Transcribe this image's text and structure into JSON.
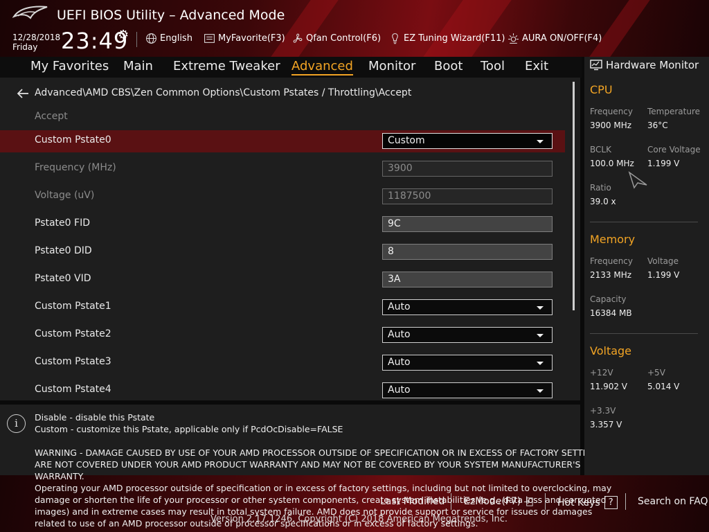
{
  "header": {
    "title": "UEFI BIOS Utility – Advanced Mode",
    "date": "12/28/2018",
    "day": "Friday",
    "time": "23:49",
    "buttons": [
      {
        "label": "English",
        "icon": "globe-icon"
      },
      {
        "label": "MyFavorite(F3)",
        "icon": "favorite-list-icon"
      },
      {
        "label": "Qfan Control(F6)",
        "icon": "fan-icon"
      },
      {
        "label": "EZ Tuning Wizard(F11)",
        "icon": "lightbulb-icon"
      },
      {
        "label": "AURA ON/OFF(F4)",
        "icon": "aura-light-icon"
      }
    ]
  },
  "menu": {
    "items": [
      "My Favorites",
      "Main",
      "Extreme Tweaker",
      "Advanced",
      "Monitor",
      "Boot",
      "Tool",
      "Exit"
    ],
    "active": "Advanced"
  },
  "main": {
    "breadcrumb": "Advanced\\AMD CBS\\Zen Common Options\\Custom Pstates / Throttling\\Accept",
    "subtitle": "Accept",
    "rows": [
      {
        "label": "Custom Pstate0",
        "value": "Custom",
        "type": "dropdown",
        "selected": true
      },
      {
        "label": "Frequency (MHz)",
        "value": "3900",
        "type": "field-disabled"
      },
      {
        "label": "Voltage (uV)",
        "value": "1187500",
        "type": "field-disabled"
      },
      {
        "label": "Pstate0 FID",
        "value": "9C",
        "type": "field"
      },
      {
        "label": "Pstate0 DID",
        "value": "8",
        "type": "field"
      },
      {
        "label": "Pstate0 VID",
        "value": "3A",
        "type": "field"
      },
      {
        "label": "Custom Pstate1",
        "value": "Auto",
        "type": "dropdown"
      },
      {
        "label": "Custom Pstate2",
        "value": "Auto",
        "type": "dropdown"
      },
      {
        "label": "Custom Pstate3",
        "value": "Auto",
        "type": "dropdown"
      },
      {
        "label": "Custom Pstate4",
        "value": "Auto",
        "type": "dropdown"
      }
    ]
  },
  "help": {
    "lines": [
      "Disable - disable this Pstate",
      "Custom - customize this Pstate, applicable only if PcdOcDisable=FALSE",
      "WARNING - DAMAGE CAUSED BY USE OF YOUR AMD PROCESSOR OUTSIDE OF SPECIFICATION OR IN EXCESS OF FACTORY SETTINGS",
      "ARE NOT COVERED UNDER YOUR AMD PRODUCT WARRANTY AND MAY NOT BE COVERED BY YOUR SYSTEM MANUFACTURER'S",
      "WARRANTY.",
      "Operating your AMD processor outside of specification or in excess of factory settings, including but not limited to overclocking, may",
      "damage or shorten the life of your processor or other system components, create system instabilities (e.g., data loss and corrupted",
      "images) and in extreme cases may result in total system failure. AMD does not provide support or service for issues or damages",
      "related to use of an AMD processor outside of processor specifications or in excess of factory settings."
    ]
  },
  "footer": {
    "last_modified": "Last Modified",
    "ezmode": "EzMode(F7)",
    "hotkeys": "Hot Keys",
    "hotkeys_key": "?",
    "faq": "Search on FAQ",
    "version": "Version 2.17.1246. Copyright (C) 2018 American Megatrends, Inc."
  },
  "hw": {
    "title": "Hardware Monitor",
    "cpu": {
      "heading": "CPU",
      "frequency_label": "Frequency",
      "frequency": "3900 MHz",
      "temperature_label": "Temperature",
      "temperature": "36°C",
      "bclk_label": "BCLK",
      "bclk": "100.0 MHz",
      "core_voltage_label": "Core Voltage",
      "core_voltage": "1.199 V",
      "ratio_label": "Ratio",
      "ratio": "39.0 x"
    },
    "memory": {
      "heading": "Memory",
      "frequency_label": "Frequency",
      "frequency": "2133 MHz",
      "voltage_label": "Voltage",
      "voltage": "1.199 V",
      "capacity_label": "Capacity",
      "capacity": "16384 MB"
    },
    "voltage": {
      "heading": "Voltage",
      "v12_label": "+12V",
      "v12": "11.902 V",
      "v5_label": "+5V",
      "v5": "5.014 V",
      "v33_label": "+3.3V",
      "v33": "3.357 V"
    }
  },
  "colors": {
    "accent": "#f2a424",
    "selected_row": "#5a1113",
    "panel": "#1e1e1e"
  }
}
